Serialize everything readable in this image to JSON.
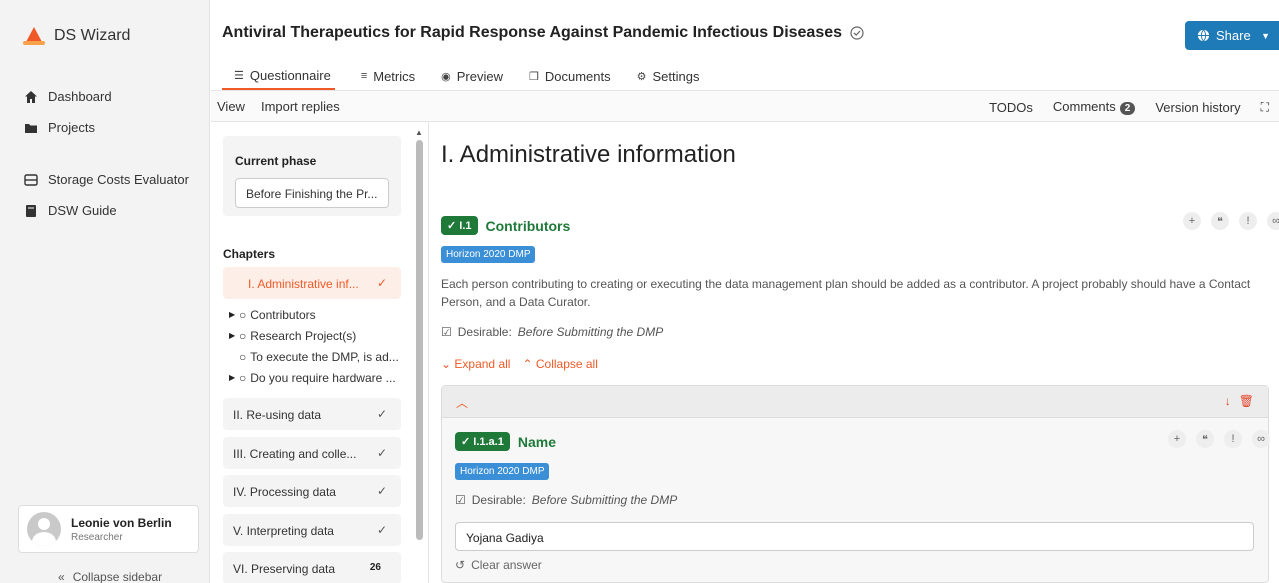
{
  "app": {
    "name": "DS Wizard",
    "brand_color": "#f05a28"
  },
  "sidebar": {
    "items": [
      {
        "label": "Dashboard",
        "icon": "home-icon"
      },
      {
        "label": "Projects",
        "icon": "folder-icon"
      },
      {
        "label": "Storage Costs Evaluator",
        "icon": "storage-icon"
      },
      {
        "label": "DSW Guide",
        "icon": "book-icon"
      }
    ],
    "user": {
      "name": "Leonie von Berlin",
      "role": "Researcher"
    },
    "collapse_label": "Collapse sidebar"
  },
  "header": {
    "title": "Antiviral Therapeutics for Rapid Response Against Pandemic Infectious Diseases",
    "share_label": "Share"
  },
  "tabs": [
    {
      "label": "Questionnaire",
      "icon": "questionnaire-icon",
      "active": true
    },
    {
      "label": "Metrics",
      "icon": "metrics-icon"
    },
    {
      "label": "Preview",
      "icon": "eye-icon"
    },
    {
      "label": "Documents",
      "icon": "documents-icon"
    },
    {
      "label": "Settings",
      "icon": "settings-icon"
    }
  ],
  "toolbar": {
    "view": "View",
    "import": "Import replies",
    "todos": "TODOs",
    "comments": "Comments",
    "comments_count": "2",
    "version_history": "Version history"
  },
  "phase": {
    "label": "Current phase",
    "value": "Before Finishing the Pr..."
  },
  "chapters": {
    "title": "Chapters",
    "active": {
      "label": "I. Administrative inf..."
    },
    "questions": [
      {
        "label": "Contributors",
        "expandable": true
      },
      {
        "label": "Research Project(s)",
        "expandable": true
      },
      {
        "label": "To execute the DMP, is ad...",
        "expandable": false
      },
      {
        "label": "Do you require hardware ...",
        "expandable": true
      }
    ],
    "others": [
      {
        "label": "II. Re-using data",
        "done": true
      },
      {
        "label": "III. Creating and colle...",
        "done": true
      },
      {
        "label": "IV. Processing data",
        "done": true
      },
      {
        "label": "V. Interpreting data",
        "done": true
      },
      {
        "label": "VI. Preserving data",
        "count": "26"
      }
    ]
  },
  "main": {
    "heading": "I. Administrative information",
    "question": {
      "badge": "✓ I.1",
      "title": "Contributors",
      "tag": "Horizon 2020 DMP",
      "description": "Each person contributing to creating or executing the data management plan should be added as a contributor. A project probably should have a Contact Person, and a Data Curator.",
      "desirable_label": "Desirable:",
      "desirable_value": "Before Submitting the DMP",
      "expand_all": "Expand all",
      "collapse_all": "Collapse all"
    },
    "item": {
      "badge": "✓ I.1.a.1",
      "title": "Name",
      "tag": "Horizon 2020 DMP",
      "desirable_label": "Desirable:",
      "desirable_value": "Before Submitting the DMP",
      "answer": "Yojana Gadiya",
      "clear_label": "Clear answer"
    }
  }
}
